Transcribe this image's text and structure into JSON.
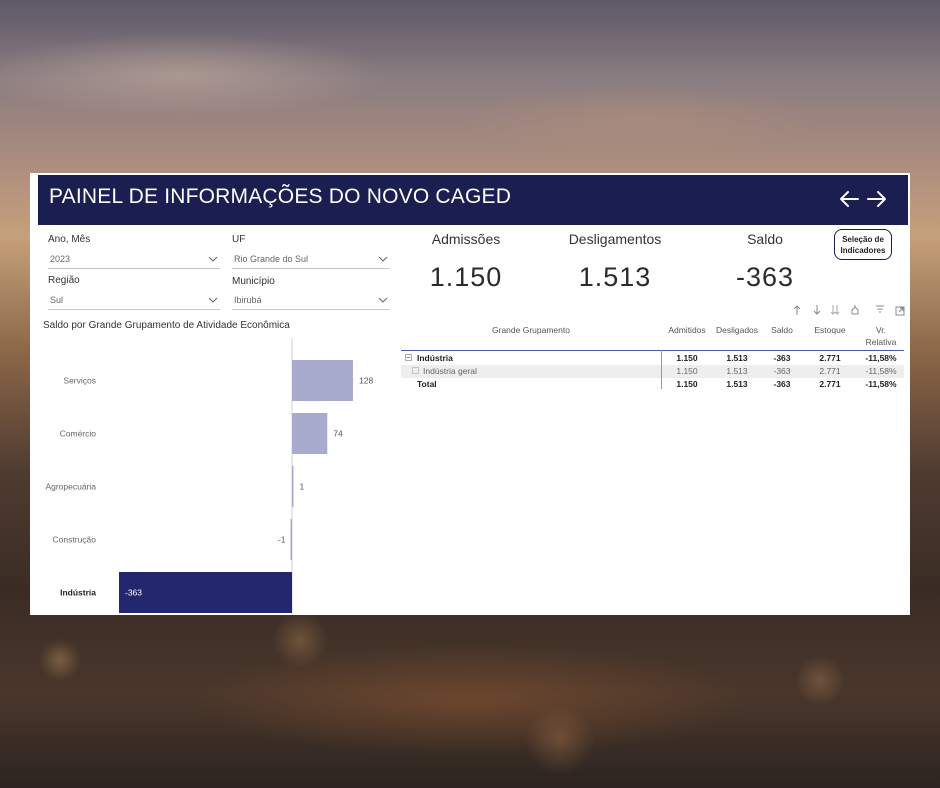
{
  "header": {
    "title": "PAINEL DE INFORMAÇÕES DO NOVO CAGED"
  },
  "filters": {
    "ano_mes": {
      "label": "Ano, Mês",
      "value": "2023"
    },
    "uf": {
      "label": "UF",
      "value": "Rio Grande do Sul"
    },
    "regiao": {
      "label": "Região",
      "value": "Sul"
    },
    "municipio": {
      "label": "Município",
      "value": "Ibirubá"
    }
  },
  "kpis": {
    "admissoes": {
      "label": "Admissões",
      "value": "1.150"
    },
    "desligamentos": {
      "label": "Desligamentos",
      "value": "1.513"
    },
    "saldo": {
      "label": "Saldo",
      "value": "-363"
    }
  },
  "selection_button": {
    "line1": "Seleção de",
    "line2": "Indicadores"
  },
  "chart_title": "Saldo por Grande Grupamento de Atividade Econômica",
  "chart_data": {
    "type": "bar",
    "orientation": "horizontal",
    "categories": [
      "Serviços",
      "Comércio",
      "Agropecuária",
      "Construção",
      "Indústria"
    ],
    "values": [
      128,
      74,
      1,
      -1,
      -363
    ],
    "value_labels": [
      "128",
      "74",
      "1",
      "-1",
      "-363"
    ],
    "highlighted": "Indústria",
    "colors": {
      "default": "#a8abcd",
      "highlight": "#23286e",
      "axis": "#d0d0d0"
    }
  },
  "table": {
    "headers": {
      "grupamento": "Grande Grupamento",
      "admitidos": "Admitidos",
      "desligados": "Desligados",
      "saldo": "Saldo",
      "estoque": "Estoque",
      "vr_line1": "Vr.",
      "vr_line2": "Relativa"
    },
    "rows": [
      {
        "name": "Indústria",
        "admitidos": "1.150",
        "desligados": "1.513",
        "saldo": "-363",
        "estoque": "2.771",
        "vr": "-11,58%"
      },
      {
        "name": "Indústria geral",
        "admitidos": "1.150",
        "desligados": "1.513",
        "saldo": "-363",
        "estoque": "2.771",
        "vr": "-11,58%"
      },
      {
        "name": "Total",
        "admitidos": "1.150",
        "desligados": "1.513",
        "saldo": "-363",
        "estoque": "2.771",
        "vr": "-11,58%"
      }
    ]
  },
  "colors": {
    "header_bg": "#1b1e50",
    "panel_bg": "#ffffff"
  }
}
